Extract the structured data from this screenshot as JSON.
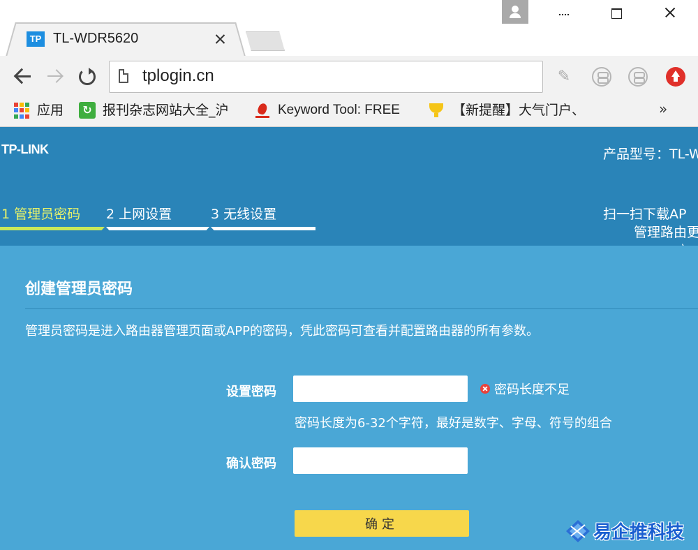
{
  "browser": {
    "tab_favicon": "TP",
    "tab_title": "TL-WDR5620",
    "url": "tplogin.cn",
    "bookmarks": {
      "apps": "应用",
      "item_1": "报刊杂志网站大全_沪",
      "item_2": "Keyword Tool: FREE",
      "item_3": "【新提醒】大气门户、",
      "more": "»"
    },
    "icons": {
      "user": "user-icon",
      "minimize": "minimize-icon",
      "maximize": "maximize-icon",
      "close": "close-icon",
      "back": "back-arrow-icon",
      "forward": "forward-arrow-icon",
      "reload": "reload-icon",
      "page": "page-icon",
      "extensions": [
        "feather-extension-icon",
        "extension-icon",
        "extension-icon",
        "upload-extension-icon"
      ]
    }
  },
  "router": {
    "logo": "TP-LINK",
    "model_label": "产品型号：TL-W",
    "steps": [
      {
        "label": "1 管理员密码",
        "active": true
      },
      {
        "label": "2 上网设置",
        "active": false
      },
      {
        "label": "3 无线设置",
        "active": false
      }
    ],
    "app_promo": {
      "line1": "扫一扫下载AP",
      "line2": "管理路由更",
      "line3": "方便"
    },
    "section_title": "创建管理员密码",
    "description": "管理员密码是进入路由器管理页面或APP的密码，凭此密码可查看并配置路由器的所有参数。",
    "form": {
      "password_label": "设置密码",
      "password_value": "",
      "error": "密码长度不足",
      "hint": "密码长度为6-32个字符，最好是数字、字母、符号的组合",
      "confirm_label": "确认密码",
      "confirm_value": "",
      "submit_label": "确定"
    },
    "colors": {
      "header_bg": "#2a84b8",
      "content_bg": "#4aa7d6",
      "active_step": "#e7f26a",
      "submit_bg": "#f7d74b",
      "error": "#e8433c"
    }
  },
  "watermark": {
    "text": "易企推科技"
  }
}
